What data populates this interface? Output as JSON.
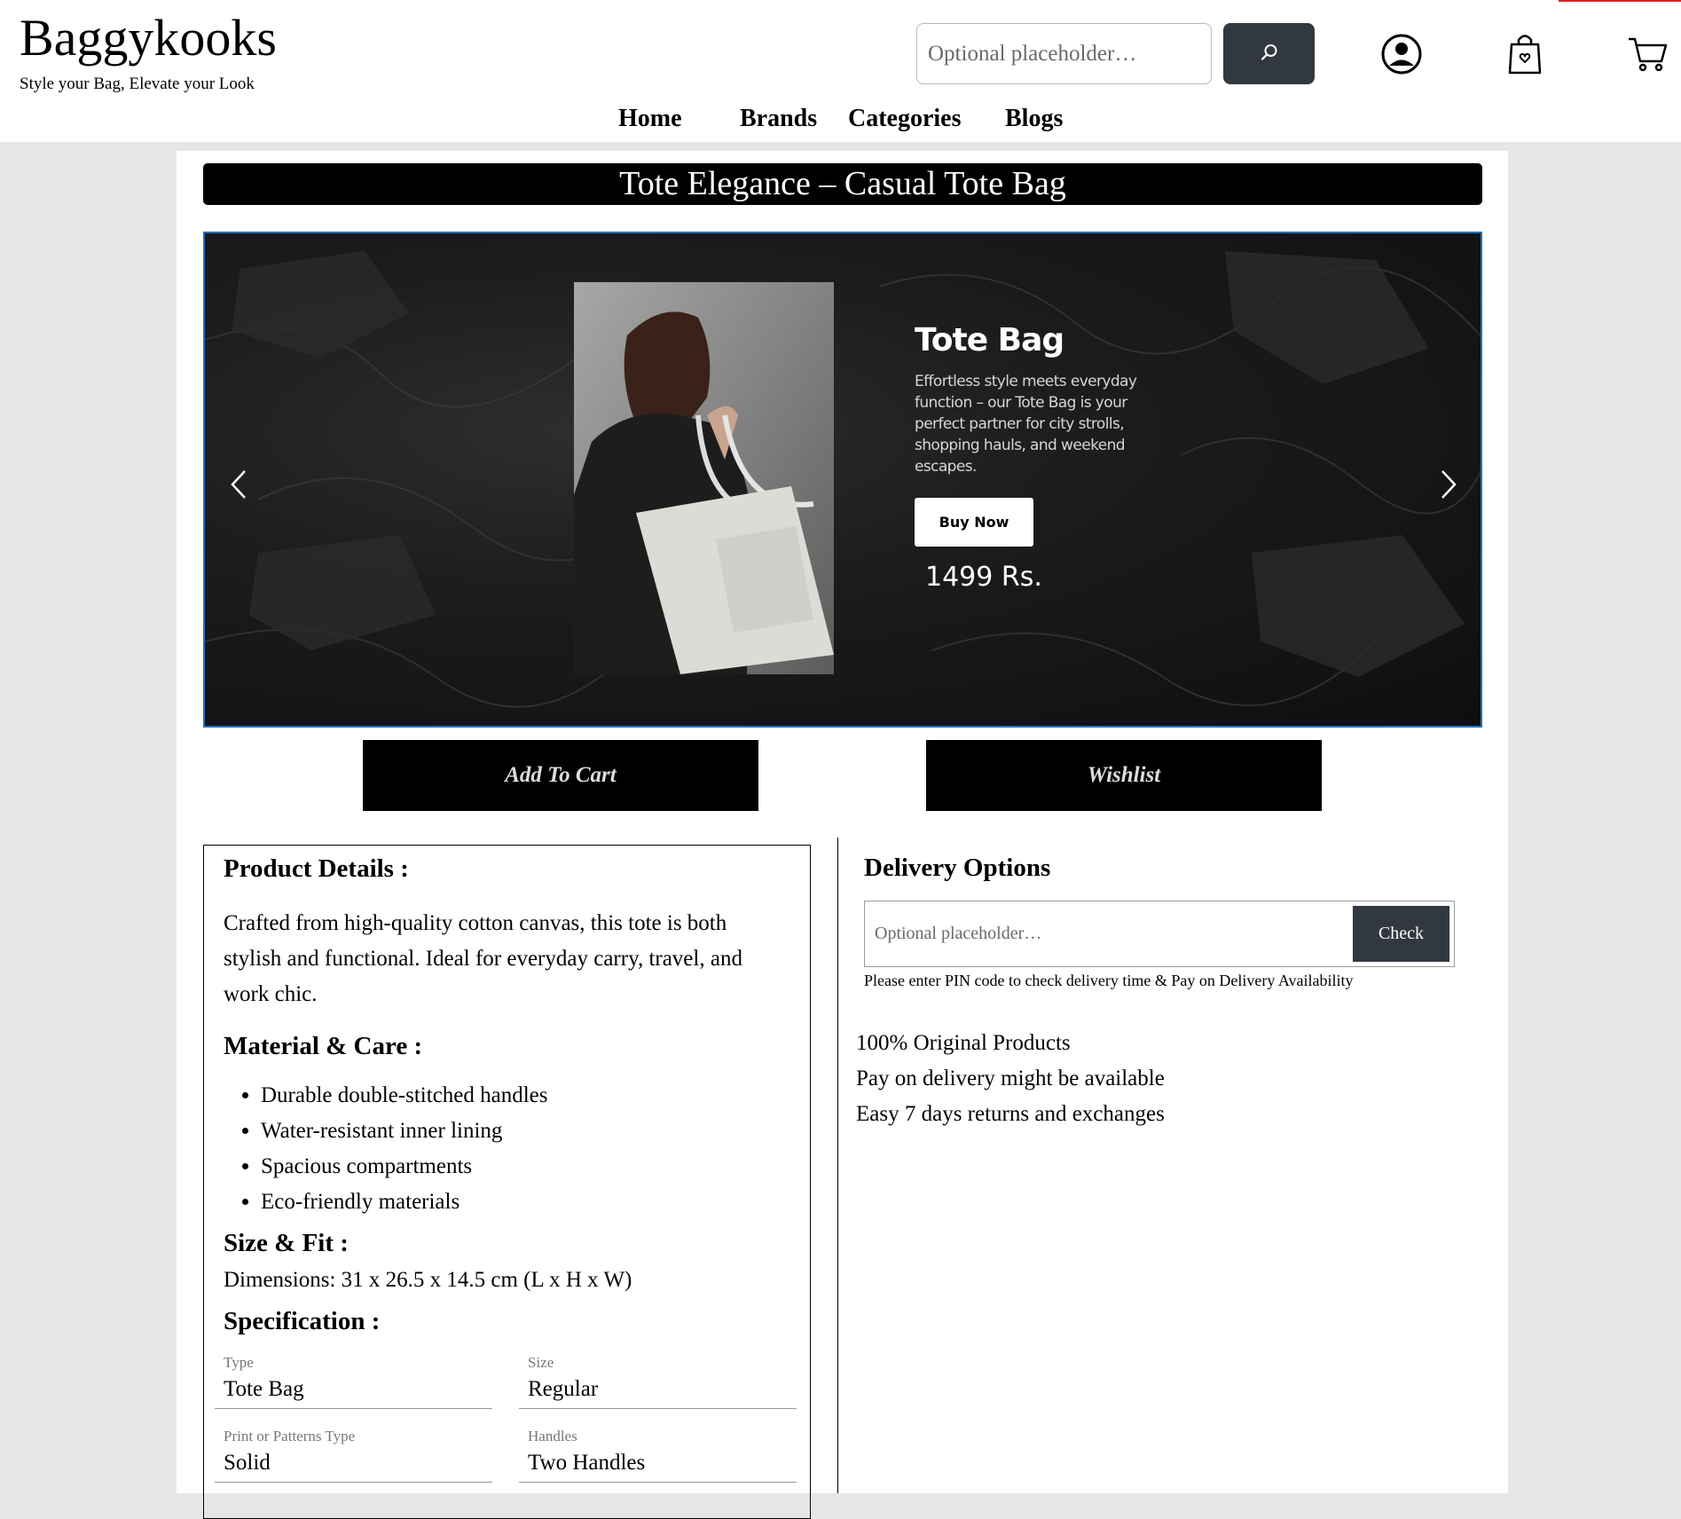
{
  "header": {
    "brand": "Baggykooks",
    "tagline": "Style your Bag, Elevate your Look",
    "search_placeholder": "Optional placeholder…",
    "search_icon": "magnifier-icon",
    "icons": [
      "user-account-icon",
      "shopping-bag-icon",
      "cart-icon"
    ]
  },
  "nav": {
    "items": [
      "Home",
      "Brands",
      "Categories",
      "Blogs"
    ]
  },
  "product": {
    "title": "Tote Elegance – Casual Tote Bag"
  },
  "carousel": {
    "slide_title": "Tote Bag",
    "slide_description": "Effortless style meets everyday function – our Tote Bag is your perfect partner for city strolls, shopping hauls, and weekend escapes.",
    "buy_label": "Buy Now",
    "price": "1499 Rs.",
    "prev_icon": "chevron-left-icon",
    "next_icon": "chevron-right-icon"
  },
  "actions": {
    "add_to_cart": "Add To Cart",
    "wishlist": "Wishlist"
  },
  "details": {
    "product_heading": "Product Details :",
    "product_text": "Crafted from high-quality cotton canvas, this tote is both stylish and functional. Ideal for everyday carry, travel, and work chic.",
    "material_heading": "Material & Care :",
    "material_items": [
      "Durable double-stitched handles",
      "Water-resistant inner lining",
      "Spacious compartments",
      "Eco-friendly materials"
    ],
    "size_heading": "Size & Fit :",
    "dimensions": "Dimensions: 31 x 26.5 x 14.5 cm (L x H x W)",
    "spec_heading": "Specification :",
    "specs": [
      {
        "label": "Type",
        "value": "Tote Bag"
      },
      {
        "label": "Size",
        "value": "Regular"
      },
      {
        "label": "Print or Patterns Type",
        "value": "Solid"
      },
      {
        "label": "Handles",
        "value": "Two Handles"
      }
    ]
  },
  "delivery": {
    "heading": "Delivery Options",
    "pin_placeholder": "Optional placeholder…",
    "check_label": "Check",
    "note": "Please enter PIN code to check delivery time & Pay on Delivery Availability",
    "assurances": [
      "100% Original Products",
      "Pay on delivery might be available",
      "Easy 7 days returns and exchanges"
    ]
  },
  "colors": {
    "accent_dark": "#323840",
    "black": "#000000",
    "carousel_border": "#1e73be",
    "page_bg": "#e6e6e6"
  }
}
